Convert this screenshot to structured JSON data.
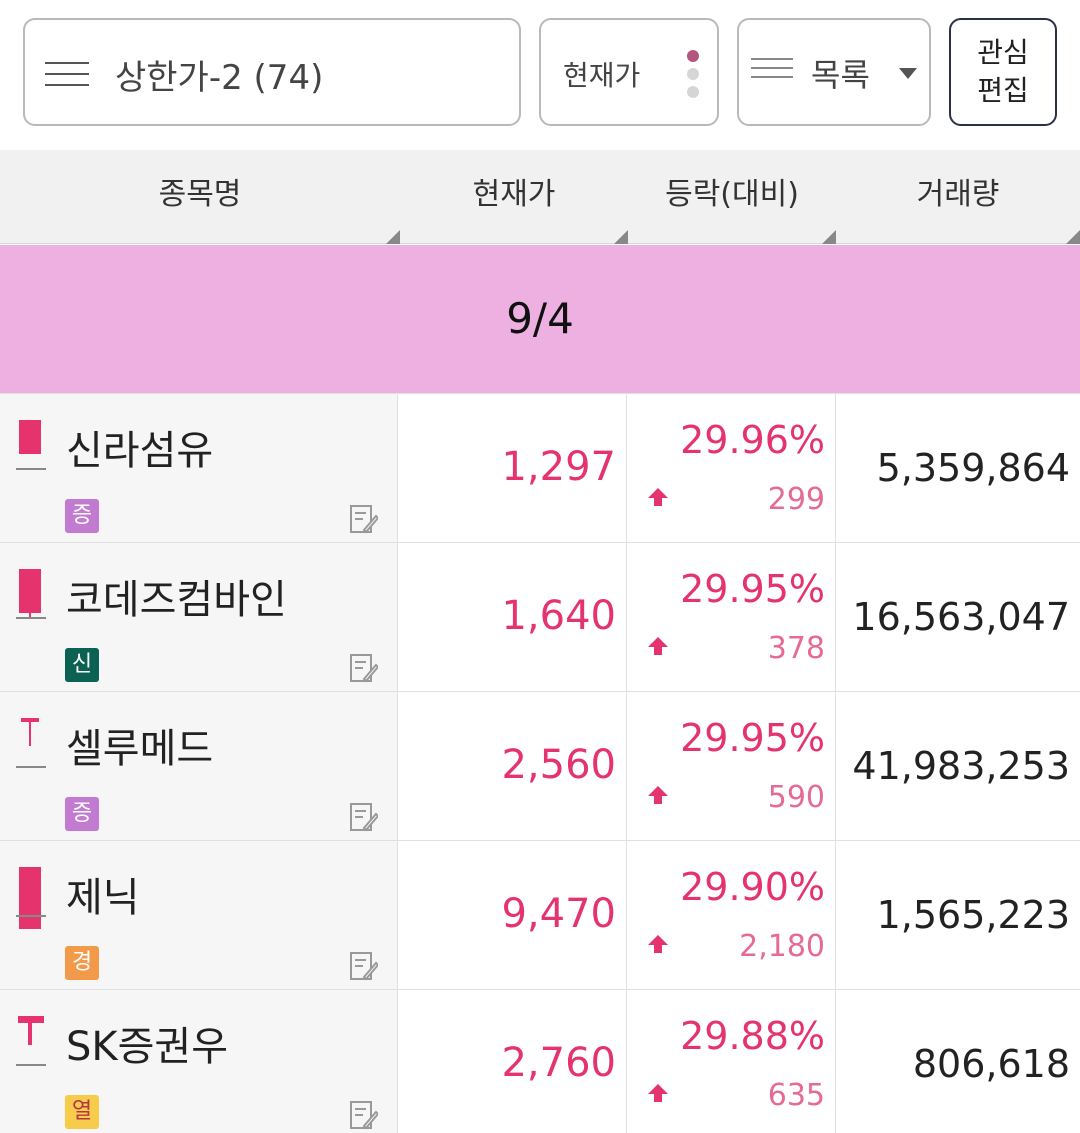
{
  "toolbar": {
    "group_label": "상한가-2 (74)",
    "price_mode_label": "현재가",
    "view_label": "목록",
    "edit_button_label_1": "관심",
    "edit_button_label_2": "편집"
  },
  "table_header": {
    "name": "종목명",
    "price": "현재가",
    "change": "등락(대비)",
    "volume": "거래량"
  },
  "date_band": "9/4",
  "colors": {
    "up": "#e5336e",
    "date_band": "#eeb0e0",
    "badge_jeung": "#c27bd0",
    "badge_sin": "#0b6152",
    "badge_gyeong": "#f39a4a",
    "badge_yeol": "#f7cc4a"
  },
  "rows": [
    {
      "name": "신라섬유",
      "market_badge": "증",
      "price": "1,297",
      "change_pct": "29.96%",
      "change_diff": "299",
      "volume": "5,359,864"
    },
    {
      "name": "코데즈컴바인",
      "market_badge": "신",
      "price": "1,640",
      "change_pct": "29.95%",
      "change_diff": "378",
      "volume": "16,563,047"
    },
    {
      "name": "셀루메드",
      "market_badge": "증",
      "price": "2,560",
      "change_pct": "29.95%",
      "change_diff": "590",
      "volume": "41,983,253"
    },
    {
      "name": "제닉",
      "market_badge": "경",
      "price": "9,470",
      "change_pct": "29.90%",
      "change_diff": "2,180",
      "volume": "1,565,223"
    },
    {
      "name": "SK증권우",
      "market_badge": "열",
      "price": "2,760",
      "change_pct": "29.88%",
      "change_diff": "635",
      "volume": "806,618"
    }
  ]
}
